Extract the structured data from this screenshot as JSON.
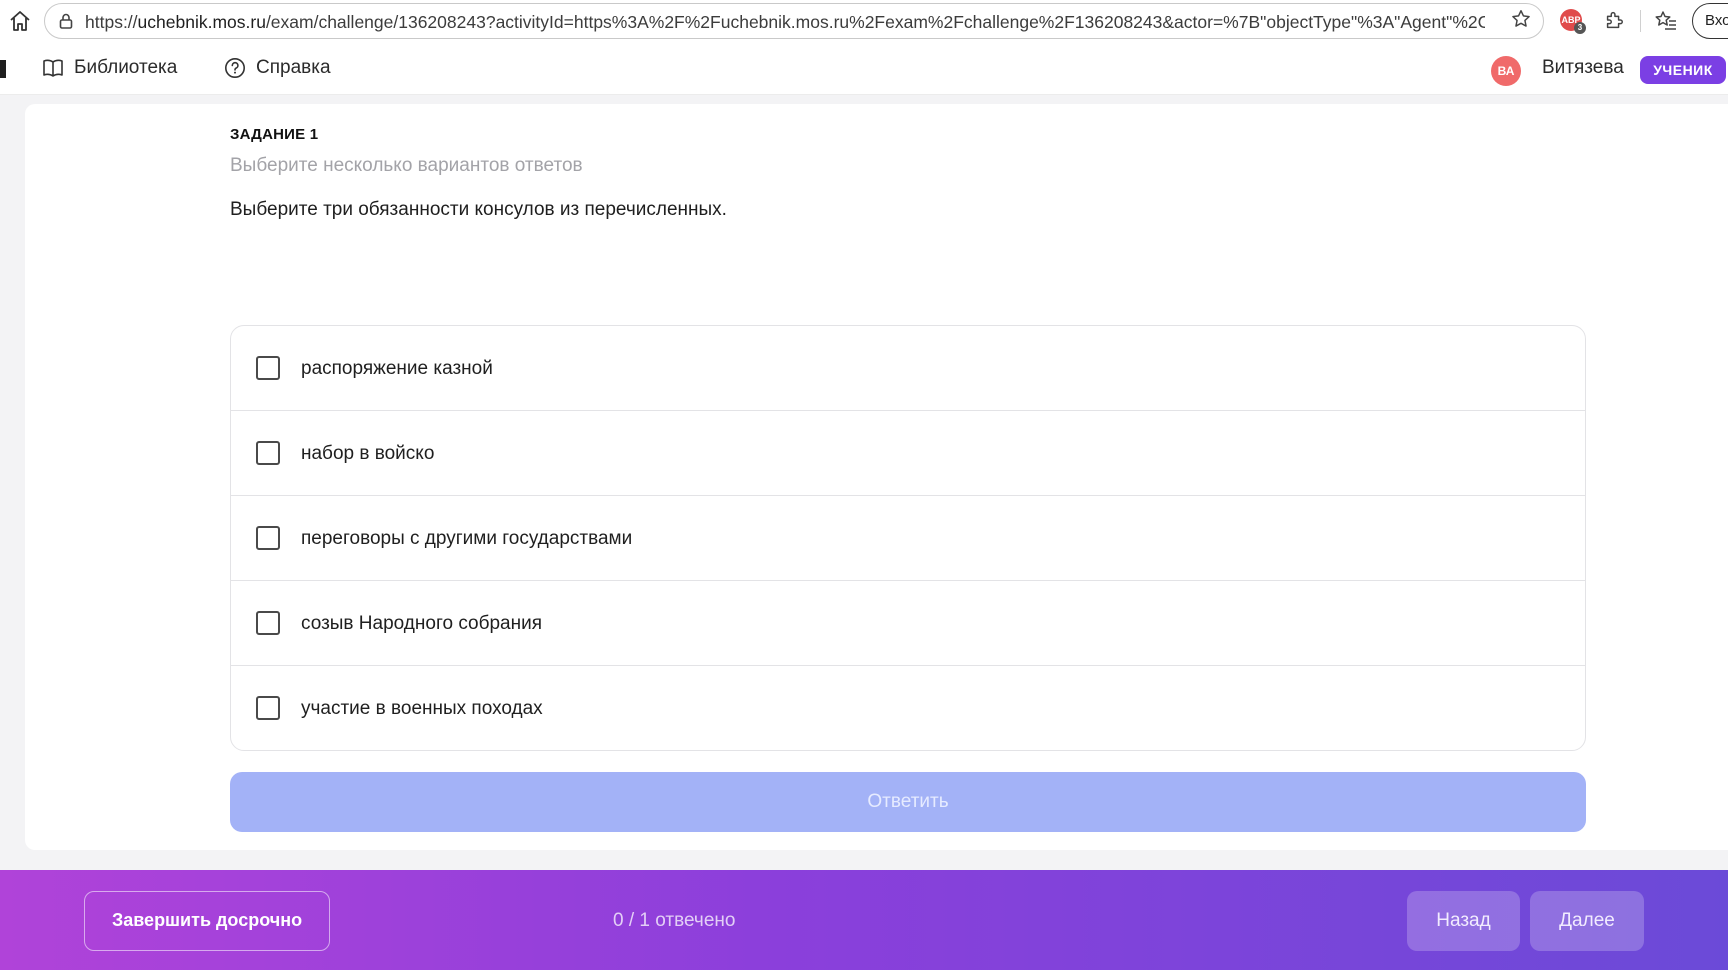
{
  "browser": {
    "url_prefix": "https://",
    "url_host": "uchebnik.mos.ru",
    "url_path": "/exam/challenge/136208243?activityId=https%3A%2F%2Fuchebnik.mos.ru%2Fexam%2Fchallenge%2F136208243&actor=%7B\"objectType\"%3A\"Agent\"%2C\"a...",
    "extension_badge": "ABP",
    "extension_count": "3",
    "login_label": "Вход"
  },
  "header": {
    "library_label": "Библиотека",
    "help_label": "Справка",
    "avatar_initials": "ВА",
    "user_name": "Витязева",
    "role_badge": "УЧЕНИК"
  },
  "task": {
    "label": "ЗАДАНИЕ 1",
    "hint": "Выберите несколько вариантов ответов",
    "question": "Выберите три обязанности консулов из перечисленных.",
    "options": [
      {
        "label": "распоряжение казной",
        "checked": false
      },
      {
        "label": "набор в войско",
        "checked": false
      },
      {
        "label": "переговоры с другими государствами",
        "checked": false
      },
      {
        "label": "созыв Народного собрания",
        "checked": false
      },
      {
        "label": "участие в военных походах",
        "checked": false
      }
    ],
    "answer_button": "Ответить"
  },
  "footer": {
    "finish_button": "Завершить досрочно",
    "progress": "0 / 1 отвечено",
    "back_button": "Назад",
    "next_button": "Далее"
  },
  "colors": {
    "accent": "#7b3fe4",
    "answer_disabled": "#a3b2f7",
    "footer_gradient_start": "#b043d9",
    "footer_gradient_end": "#6b4ad8",
    "avatar": "#f06a6a"
  }
}
